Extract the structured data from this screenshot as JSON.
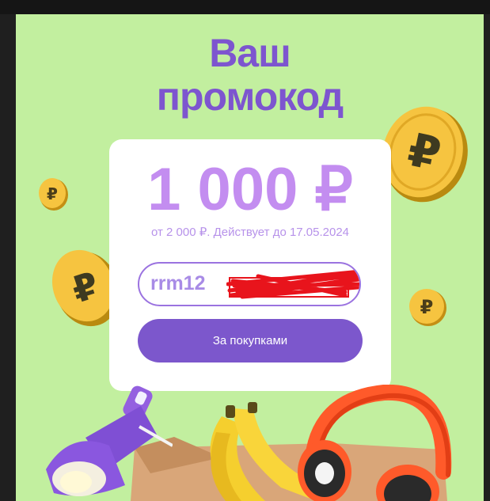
{
  "title": {
    "line1": "Ваш",
    "line2": "промокод"
  },
  "promo": {
    "amount": "1 000 ₽",
    "condition": "от 2 000 ₽. Действует до 17.05.2024",
    "code": "rrm12"
  },
  "button": {
    "label": "За покупками"
  },
  "colors": {
    "background": "#c2ef9f",
    "accent": "#7d55cf",
    "amount": "#c38df0",
    "button": "#7c57cc"
  },
  "icons": [
    "ruble-coin-icon",
    "desk-lamp-icon",
    "bananas-icon",
    "headphones-icon",
    "paper-bag-icon"
  ]
}
